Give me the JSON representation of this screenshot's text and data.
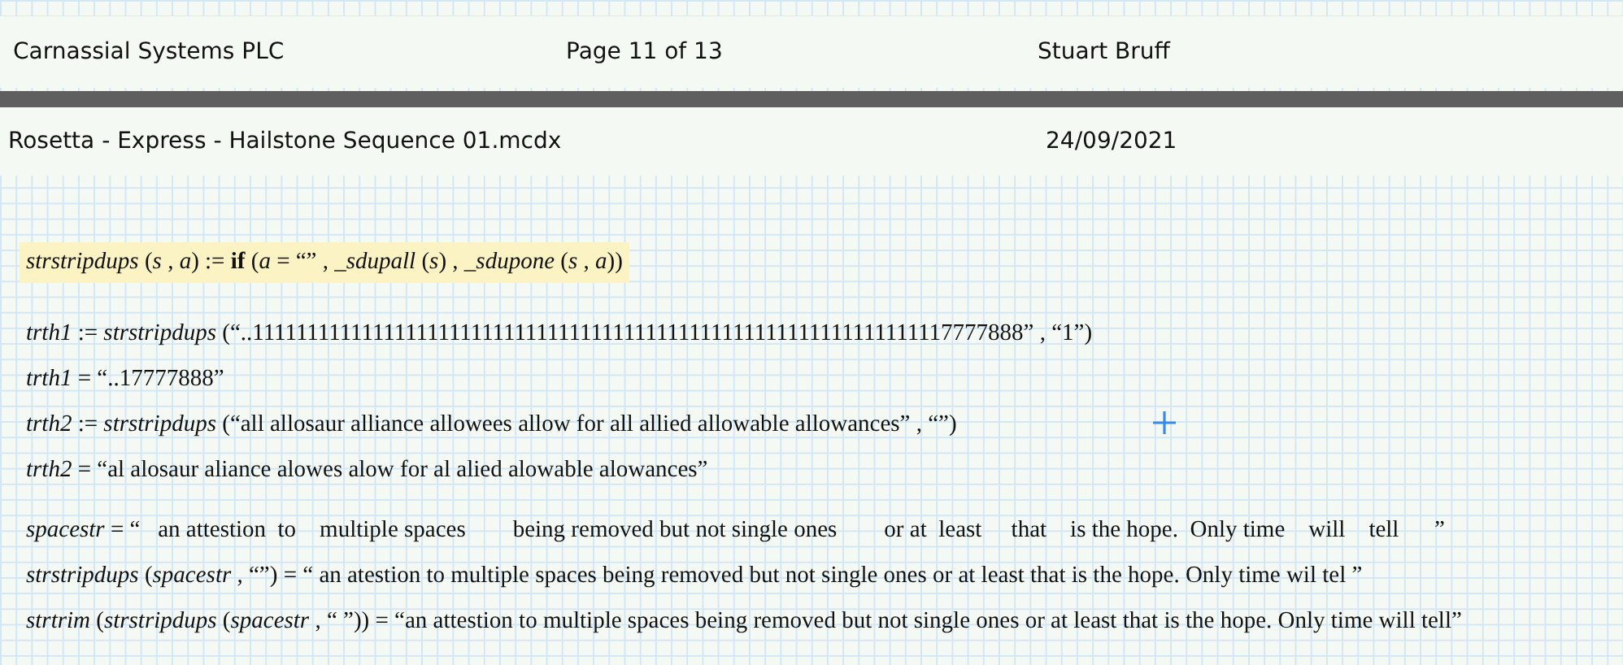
{
  "header": {
    "company": "Carnassial Systems PLC",
    "page": "Page 11 of 13",
    "author": "Stuart Bruff"
  },
  "footer": {
    "file": "Rosetta - Express - Hailstone Sequence 01.mcdx",
    "date": "24/09/2021"
  },
  "regions": [
    {
      "kind": "math",
      "highlighted": true,
      "text": "*strstripdups* (*s* , *a*) := **if** (*a* = “” , *_sdupall* (*s*) , *_sdupone* (*s* , *a*))"
    },
    {
      "kind": "math",
      "highlighted": false,
      "text": "*trth1* := *strstripdups* (“..1111111111111111111111111111111111111111111111111111111111111117777888” , “1”)"
    },
    {
      "kind": "math",
      "highlighted": false,
      "text": "*trth1* = “..17777888”"
    },
    {
      "kind": "math",
      "highlighted": false,
      "text": "*trth2* := *strstripdups* (“all allosaur alliance allowees allow for all allied allowable allowances” , “”)"
    },
    {
      "kind": "math",
      "highlighted": false,
      "text": "*trth2* = “al alosaur aliance alowes alow for al alied alowable alowances”"
    },
    {
      "kind": "math",
      "highlighted": false,
      "text": "*spacestr* = “   an attestion  to    multiple spaces        being removed but not single ones        or at  least     that    is the hope.  Only time    will    tell      ”"
    },
    {
      "kind": "math",
      "highlighted": false,
      "text": "*strstripdups* (*spacestr* , “”) = “ an atestion to multiple spaces being removed but not single ones or at least that is the hope. Only time wil tel ”"
    },
    {
      "kind": "math",
      "highlighted": false,
      "text": "*strtrim* (*strstripdups* (*spacestr* , “ ”)) = “an attestion to multiple spaces being removed but not single ones or at least that is the hope. Only time will tell”"
    }
  ]
}
